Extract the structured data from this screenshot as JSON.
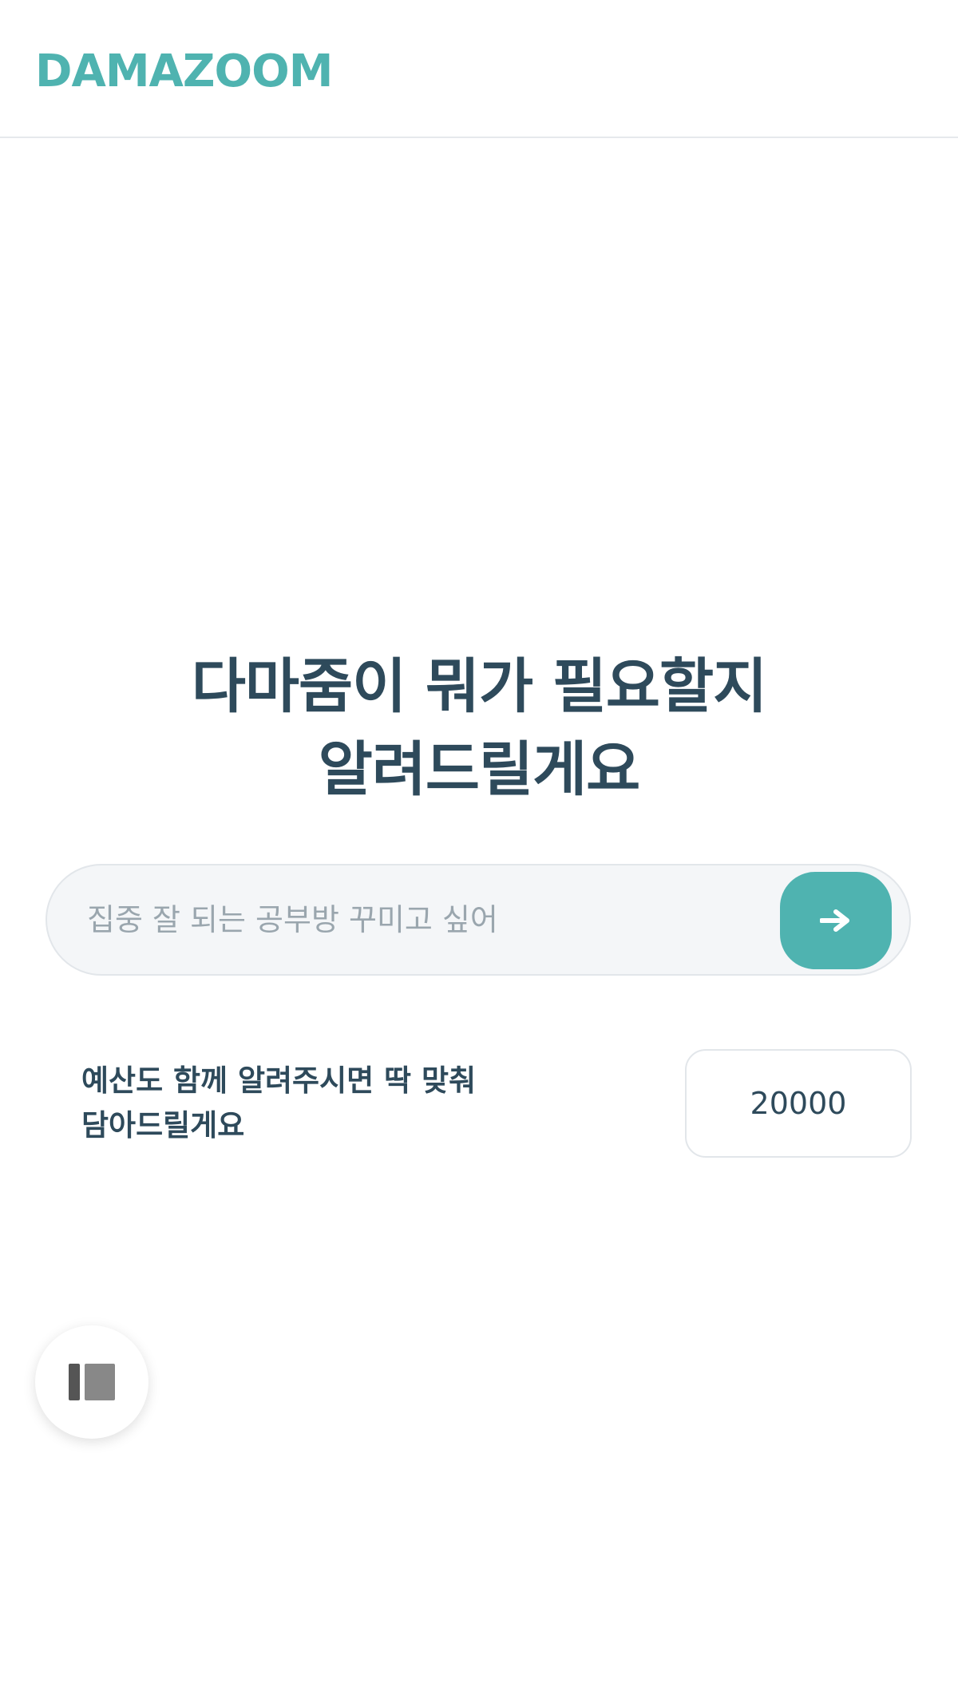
{
  "header": {
    "logo": "DAMAZOOM"
  },
  "hero": {
    "title_line1": "다마줌이 뭐가 필요할지",
    "title_line2": "알려드릴게요"
  },
  "search": {
    "placeholder": "집중 잘 되는 공부방 꾸미고 싶어",
    "value": "",
    "submit_icon": "arrow-right-icon"
  },
  "budget": {
    "label_line1": "예산도 함께 알려주시면 딱 맞춰",
    "label_line2": "담아드릴게요",
    "value": "20000"
  },
  "floating": {
    "icon": "sidebar-toggle-icon"
  },
  "colors": {
    "accent": "#4fb3b0",
    "text": "#2e4a5b",
    "input_bg": "#f4f6f8",
    "placeholder": "#9aa6ae"
  }
}
